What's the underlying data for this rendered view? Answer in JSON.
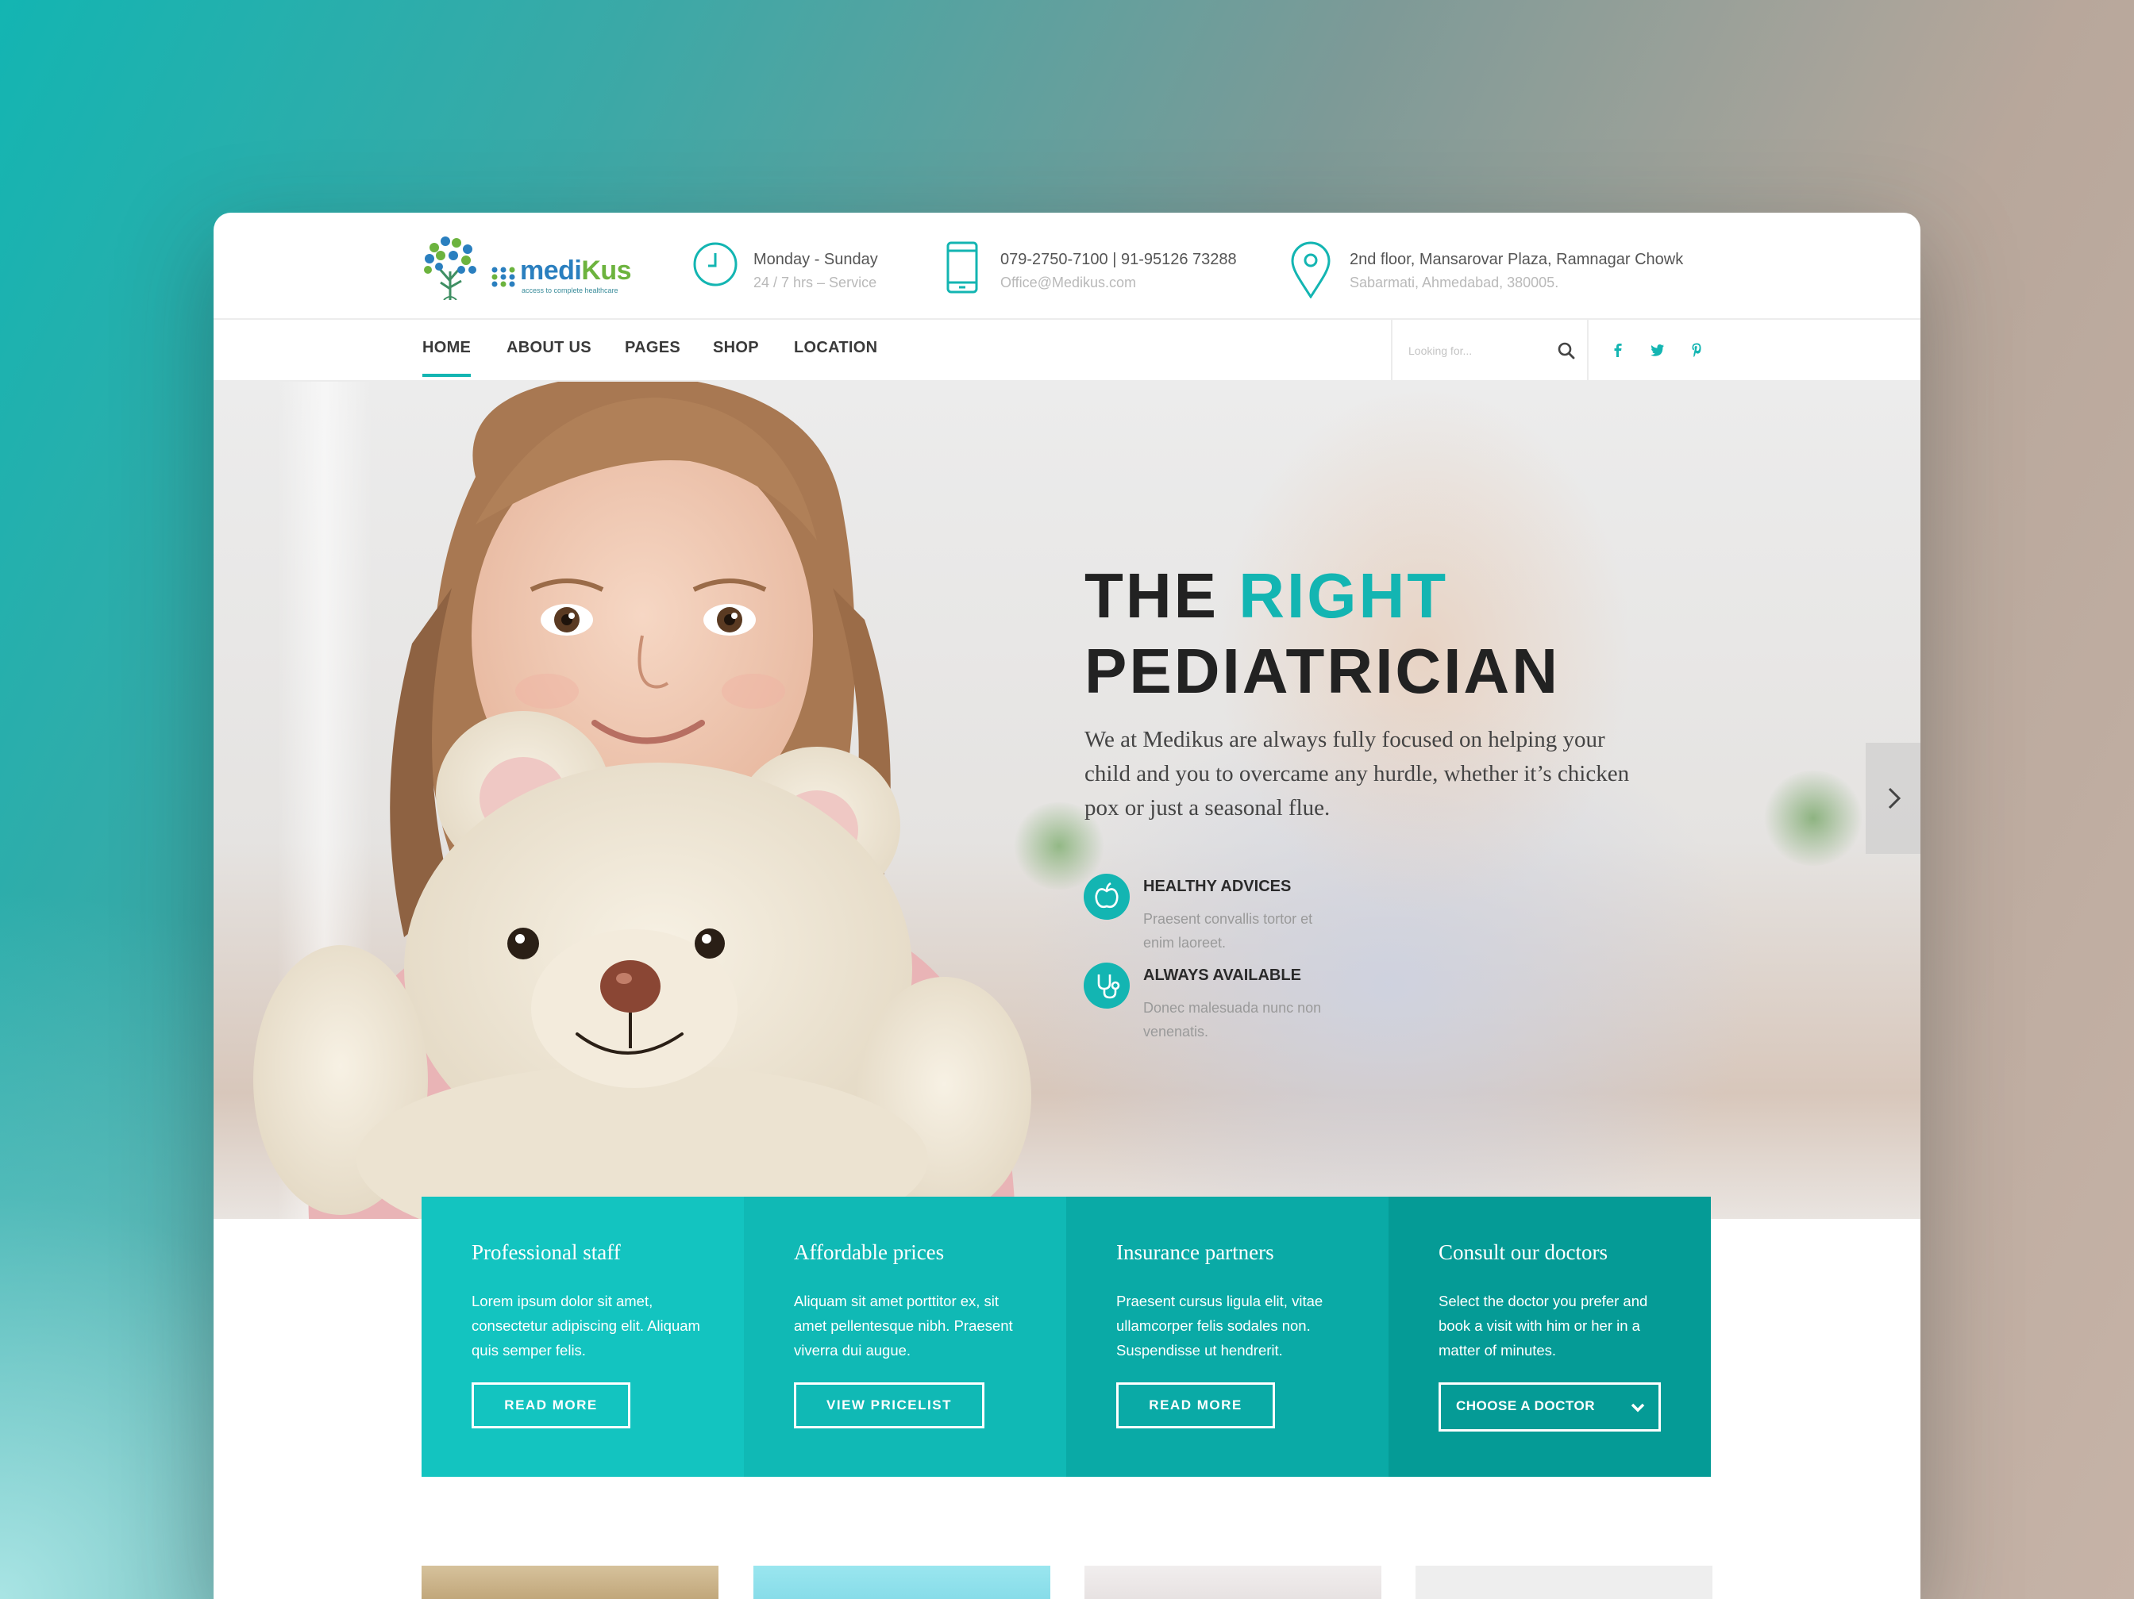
{
  "brand": {
    "name_part1": "medi",
    "name_part2": "Kus",
    "tagline": "access to complete healthcare"
  },
  "contact": {
    "hours_title": "Monday - Sunday",
    "hours_sub": "24 / 7 hrs – Service",
    "phone_title": "079-2750-7100 | 91-95126 73288",
    "phone_sub": "Office@Medikus.com",
    "address_title": "2nd floor, Mansarovar Plaza, Ramnagar Chowk",
    "address_sub": "Sabarmati, Ahmedabad, 380005."
  },
  "nav": {
    "items": [
      {
        "label": "HOME",
        "active": true
      },
      {
        "label": "ABOUT US"
      },
      {
        "label": "PAGES"
      },
      {
        "label": "SHOP"
      },
      {
        "label": "LOCATION"
      }
    ],
    "search_placeholder": "Looking for...",
    "social_icons": [
      "facebook-icon",
      "twitter-icon",
      "pinterest-icon"
    ]
  },
  "hero": {
    "title_part1": "THE ",
    "title_accent": "RIGHT",
    "title_line2": "PEDIATRICIAN",
    "text": "We at Medikus are always fully focused on helping your child and you to overcame any hurdle, whether it’s chicken pox or just a seasonal flue.",
    "features": [
      {
        "title": "HEALTHY ADVICES",
        "text": "Praesent convallis tortor et enim laoreet.",
        "icon": "apple-icon"
      },
      {
        "title": "ALWAYS AVAILABLE",
        "text": "Donec malesuada nunc non venenatis.",
        "icon": "stethoscope-icon"
      }
    ]
  },
  "boxes": [
    {
      "title": "Professional staff",
      "text": "Lorem ipsum dolor sit amet, consectetur adipiscing elit. Aliquam quis semper felis.",
      "button": "READ MORE",
      "color": "#13c4c0"
    },
    {
      "title": "Affordable prices",
      "text": "Aliquam sit amet porttitor ex, sit amet pellentesque nibh. Praesent viverra dui augue.",
      "button": "VIEW PRICELIST",
      "color": "#10b9b5"
    },
    {
      "title": "Insurance partners",
      "text": "Praesent cursus ligula elit, vitae ullamcorper felis sodales non. Suspendisse ut hendrerit.",
      "button": "READ MORE",
      "color": "#0aaaa6"
    },
    {
      "title": "Consult our doctors",
      "text": "Select the doctor you prefer and book a visit with him or her in a matter of minutes.",
      "select_value": "CHOOSE A DOCTOR",
      "color": "#059b96"
    }
  ],
  "theme": {
    "accent": "#13b5b2",
    "text_dark": "#222222"
  }
}
